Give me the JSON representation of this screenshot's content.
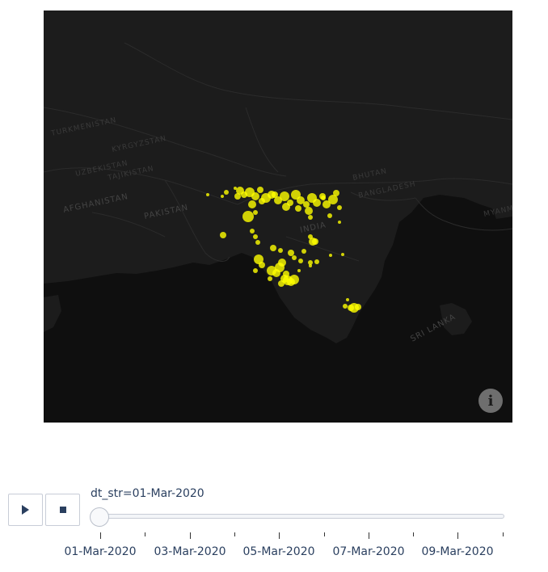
{
  "map": {
    "basemap": "dark",
    "marker_color": "#ffff00",
    "labels": {
      "afghanistan": "AFGHANISTAN",
      "pakistan": "PAKISTAN",
      "india": "INDIA",
      "sri_lanka": "SRI LANKA",
      "bangladesh": "BANGLADESH",
      "bhutan": "BHUTAN",
      "tajikistan": "TAJIKISTAN",
      "kyrgyzstan": "KYRGYZSTAN",
      "uzbekistan": "UZBEKISTAN",
      "turkmenistan": "TURKMENISTAN",
      "myanmar": "MYANMAR"
    },
    "info_icon": "info-icon"
  },
  "animation": {
    "play_icon": "play-icon",
    "stop_icon": "stop-icon",
    "current_label": "dt_str=01-Mar-2020",
    "current_index": 0,
    "tick_labels": [
      "01-Mar-2020",
      "03-Mar-2020",
      "05-Mar-2020",
      "07-Mar-2020",
      "09-Mar-2020"
    ]
  }
}
